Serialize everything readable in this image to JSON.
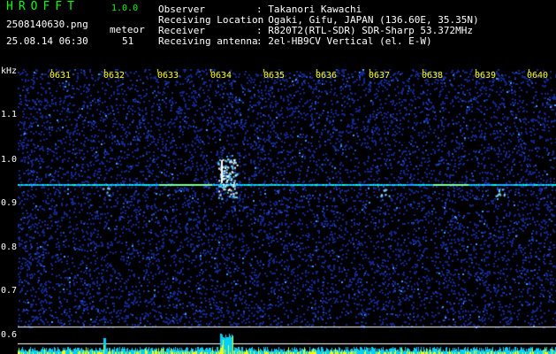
{
  "header": {
    "app_title": "HROFFT",
    "app_version": "1.0.0",
    "file_name": "2508140630.png",
    "datetime": "25.08.14 06:30",
    "meteor_label": "meteor",
    "meteor_count": "51"
  },
  "info": [
    {
      "label": "Observer",
      "value": ": Takanori Kawachi"
    },
    {
      "label": "Receiving Location",
      "value": ": Ogaki, Gifu, JAPAN (136.60E, 35.35N)"
    },
    {
      "label": "Receiver",
      "value": ": R820T2(RTL-SDR) SDR-Sharp 53.372MHz"
    },
    {
      "label": "Receiving antenna",
      "value": ": 2el-HB9CV Vertical (el. E-W)"
    }
  ],
  "spectrogram": {
    "y_unit": "kHz",
    "y_ticks": [
      "1.1",
      "1.0",
      "0.9",
      "0.8",
      "0.7",
      "0.6"
    ],
    "x_ticks": [
      "0631",
      "0632",
      "0633",
      "0634",
      "0635",
      "0636",
      "0637",
      "0638",
      "0639",
      "0640"
    ],
    "carrier_khz": 0.94,
    "colors": {
      "background": "#000000",
      "noise": "#0a1a7a",
      "signal": "#00e0ff",
      "bars": "#ffff00",
      "label": "#ffff00"
    }
  }
}
